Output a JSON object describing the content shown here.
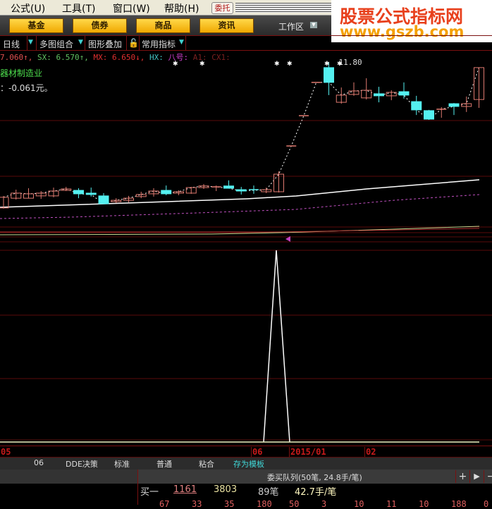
{
  "menubar": {
    "items": [
      "公式(U)",
      "工具(T)",
      "窗口(W)",
      "帮助(H)"
    ],
    "weituo": "委托"
  },
  "toolbar": {
    "buttons": [
      "基金",
      "债券",
      "商品",
      "资讯"
    ],
    "workarea": "工作区",
    "workarea_icon": "dropdown-icon"
  },
  "watermark": {
    "line1": "股票公式指标网",
    "line2": "www.gszb.com"
  },
  "tabs": {
    "period": "日线",
    "multi": "多图组合",
    "overlay": "图形叠加",
    "indicators": "常用指标"
  },
  "indicator": {
    "parts": [
      {
        "text": "7.060↑,",
        "color": "#e05050"
      },
      {
        "text": " SX: 6.570↑,",
        "color": "#60c060"
      },
      {
        "text": " MX: 6.650↓,",
        "color": "#e03030"
      },
      {
        "text": " HX:",
        "color": "#40c0c0"
      },
      {
        "text": " 八号:",
        "color": "#d040d0"
      },
      {
        "text": " A1:",
        "color": "#7a2020"
      },
      {
        "text": " CX1:",
        "color": "#7a2020"
      }
    ]
  },
  "info": {
    "industry": "器材制造业",
    "eps": "：-0.061元。"
  },
  "chart": {
    "high_label": "11.80",
    "up_color": "#e07a70",
    "down_color": "#54f0f0",
    "candles": [
      [
        5.55,
        6.07,
        5.52,
        6.01
      ],
      [
        5.97,
        6.34,
        5.91,
        6.19
      ],
      [
        5.97,
        6.4,
        5.97,
        6.16
      ],
      [
        6.07,
        6.28,
        5.94,
        6.19
      ],
      [
        6.07,
        6.43,
        6.01,
        6.28
      ],
      [
        6.31,
        6.46,
        6.28,
        6.37
      ],
      [
        6.31,
        6.4,
        5.97,
        6.16
      ],
      [
        6.19,
        6.43,
        6.04,
        6.13
      ],
      [
        6.07,
        6.19,
        5.73,
        5.73
      ],
      [
        5.82,
        5.97,
        5.76,
        5.88
      ],
      [
        5.88,
        6.07,
        5.79,
        5.97
      ],
      [
        6.04,
        6.25,
        5.97,
        6.13
      ],
      [
        6.16,
        6.4,
        6.04,
        6.28
      ],
      [
        6.31,
        6.52,
        6.1,
        6.16
      ],
      [
        6.19,
        6.31,
        6.1,
        6.25
      ],
      [
        6.19,
        6.46,
        6.16,
        6.43
      ],
      [
        6.43,
        6.58,
        6.37,
        6.5
      ],
      [
        6.43,
        6.52,
        6.28,
        6.46
      ],
      [
        6.5,
        6.74,
        6.4,
        6.4
      ],
      [
        6.34,
        6.46,
        6.13,
        6.28
      ],
      [
        6.34,
        6.52,
        6.16,
        6.31
      ],
      [
        6.25,
        6.43,
        6.19,
        6.34
      ],
      [
        6.25,
        7.13,
        6.22,
        7.01
      ],
      [
        8.23,
        8.23,
        8.23,
        8.23
      ],
      [
        9.54,
        9.54,
        9.54,
        9.54
      ],
      [
        10.98,
        10.98,
        10.98,
        10.98
      ],
      [
        11.62,
        11.86,
        10.43,
        10.98
      ],
      [
        10.12,
        10.76,
        10.06,
        10.43
      ],
      [
        10.46,
        10.98,
        10.4,
        10.61
      ],
      [
        10.31,
        11.16,
        10.24,
        10.64
      ],
      [
        10.49,
        10.79,
        10.12,
        10.4
      ],
      [
        10.4,
        10.64,
        10.21,
        10.55
      ],
      [
        10.58,
        10.98,
        10.28,
        10.43
      ],
      [
        10.15,
        10.4,
        9.57,
        9.79
      ],
      [
        9.76,
        9.79,
        9.36,
        9.39
      ],
      [
        9.79,
        9.91,
        9.45,
        9.82
      ],
      [
        10.06,
        10.09,
        9.57,
        9.94
      ],
      [
        9.94,
        10.37,
        9.7,
        10.06
      ],
      [
        10.24,
        11.62,
        9.88,
        11.62
      ]
    ]
  },
  "dates": [
    "05",
    "06",
    "2015/01",
    "02"
  ],
  "bottom_tabs": [
    "06",
    "DDE决策",
    "标准",
    "普通",
    "粘合",
    "存为模板"
  ],
  "queue": {
    "title": "委买队列(50笔, 24.8手/笔)",
    "plus": "+",
    "next": "▶",
    "minus": "−",
    "label": "买一",
    "price": "1161",
    "volume": "3803",
    "count": "89笔",
    "avg": "42.7手/笔",
    "orders": [
      "67",
      "33",
      "35",
      "180",
      "50",
      "3",
      "10",
      "11",
      "10",
      "188",
      "0"
    ]
  }
}
